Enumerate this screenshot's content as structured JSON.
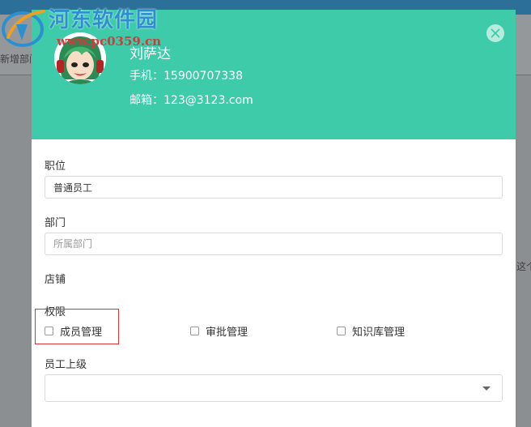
{
  "background": {
    "left_text": "新增部门",
    "right_text": "这个"
  },
  "watermark": {
    "site_name": "河东软件园",
    "url": "www.pc0359.cn"
  },
  "profile": {
    "name": "刘萨达",
    "phone": "手机：15900707338",
    "email": "邮箱：123@3123.com"
  },
  "form": {
    "position": {
      "label": "职位",
      "value": "普通员工"
    },
    "department": {
      "label": "部门",
      "placeholder": "所属部门",
      "value": ""
    },
    "store": {
      "label": "店铺"
    },
    "permissions": {
      "label": "权限",
      "items": [
        {
          "label": "成员管理",
          "checked": false
        },
        {
          "label": "审批管理",
          "checked": false
        },
        {
          "label": "知识库管理",
          "checked": false
        }
      ]
    },
    "supervisor": {
      "label": "员工上级",
      "selected": ""
    }
  },
  "colors": {
    "header": "#3dcbaa",
    "highlight": "#d9322f",
    "watermark_blue": "#2e8fd0",
    "watermark_red": "#d13a3a"
  },
  "icons": {
    "close": "close-icon",
    "dropdown": "chevron-down-icon",
    "logo": "logo-icon"
  }
}
